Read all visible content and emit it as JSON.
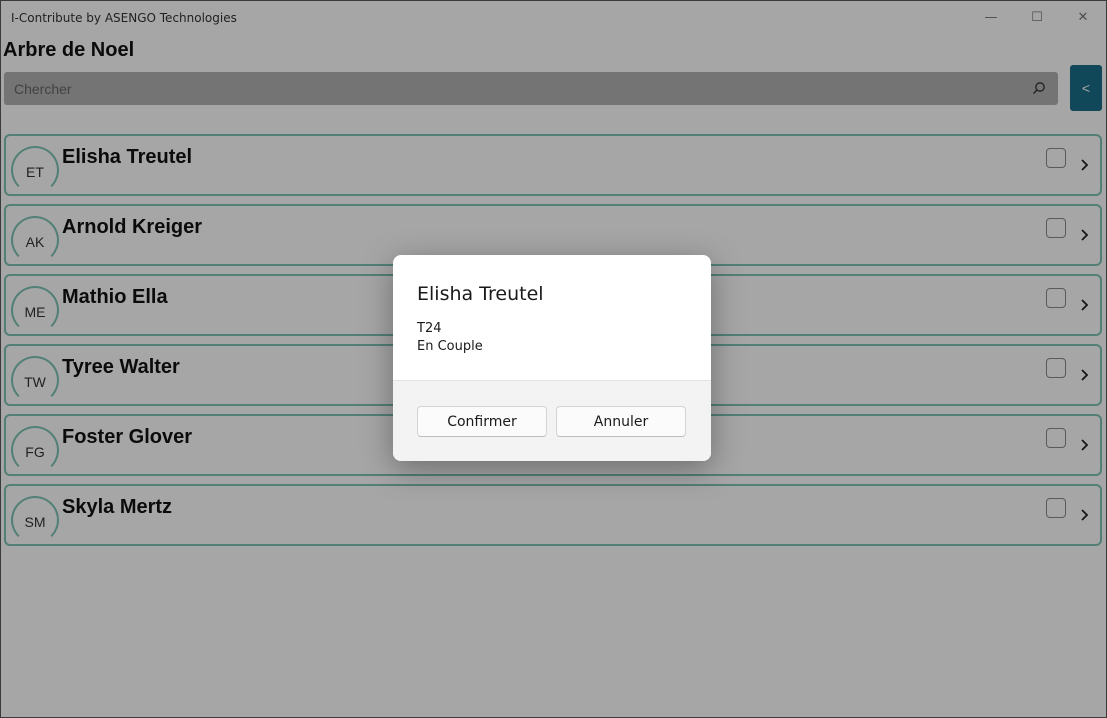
{
  "window": {
    "title": "I-Contribute by ASENGO Technologies",
    "minimize_icon": "minimize-icon",
    "maximize_icon": "maximize-icon",
    "close_icon": "close-icon"
  },
  "page": {
    "title": "Arbre de Noel"
  },
  "search": {
    "placeholder": "Chercher",
    "value": "",
    "icon": "search-icon"
  },
  "back_button": {
    "label": "<"
  },
  "people": [
    {
      "initials": "ET",
      "name": "Elisha Treutel",
      "checked": false
    },
    {
      "initials": "AK",
      "name": "Arnold Kreiger",
      "checked": false
    },
    {
      "initials": "ME",
      "name": "Mathio Ella",
      "checked": false
    },
    {
      "initials": "TW",
      "name": "Tyree Walter",
      "checked": false
    },
    {
      "initials": "FG",
      "name": "Foster Glover",
      "checked": false
    },
    {
      "initials": "SM",
      "name": "Skyla Mertz",
      "checked": false
    }
  ],
  "dialog": {
    "title": "Elisha Treutel",
    "line1": "T24",
    "line2": "En Couple",
    "confirm_label": "Confirmer",
    "cancel_label": "Annuler"
  },
  "colors": {
    "accent": "#1a6f8a",
    "item_border": "#7fc4b6",
    "overlay": "rgba(0,0,0,0.35)"
  }
}
